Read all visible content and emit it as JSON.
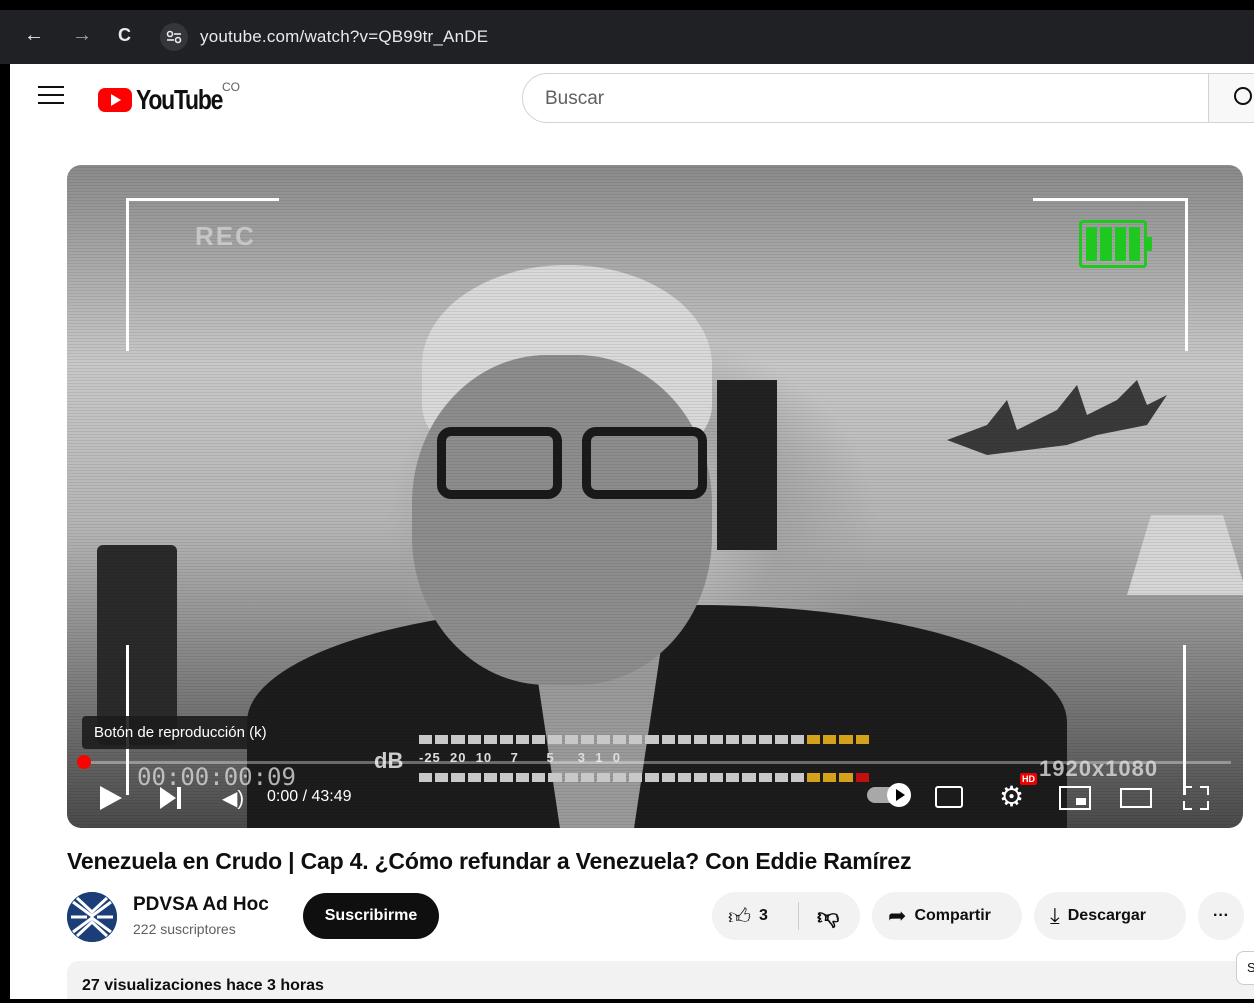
{
  "browser": {
    "url": "youtube.com/watch?v=QB99tr_AnDE",
    "back_icon": "←",
    "forward_icon": "→",
    "reload_icon": "C",
    "site_info_icon": "⚙"
  },
  "header": {
    "logo_text": "YouTube",
    "country_code": "CO",
    "search_placeholder": "Buscar"
  },
  "player": {
    "rec_overlay": "REC",
    "tooltip": "Botón de reproducción (k)",
    "timecode_overlay": "00:00:00:09",
    "time_display": "0:00 / 43:49",
    "db_label": "dB",
    "meter_scale": "-25  20  10    7      5     3  1  0",
    "resolution_overlay": "1920x1080",
    "hd_badge": "HD",
    "progress": 0,
    "accent_color": "#ff0000",
    "battery_color": "#1ec81e"
  },
  "video": {
    "title": "Venezuela en Crudo | Cap 4. ¿Cómo refundar a Venezuela? Con Eddie Ramírez",
    "channel_name": "PDVSA Ad Hoc",
    "subscribers": "222 suscriptores",
    "subscribe_label": "Suscribirme",
    "like_count": "3",
    "share_label": "Compartir",
    "download_label": "Descargar",
    "more_label": "···",
    "views_line": "27 visualizaciones  hace 3 horas",
    "side_chip": "S"
  }
}
